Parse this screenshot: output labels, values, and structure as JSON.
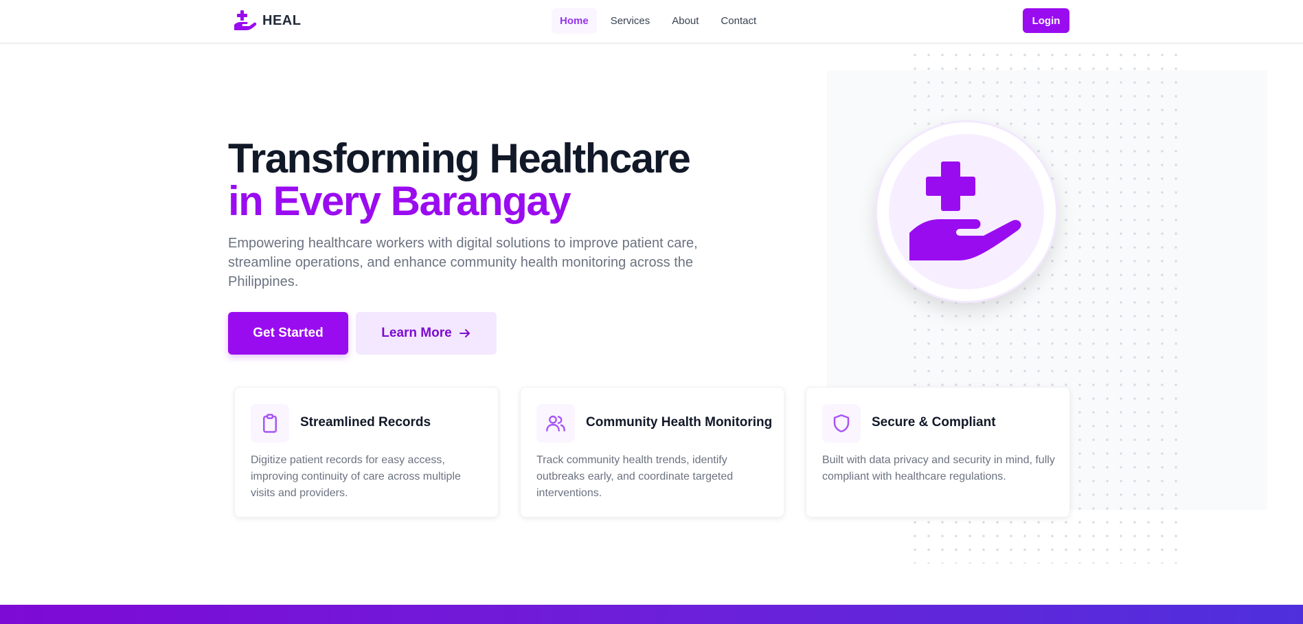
{
  "brand": {
    "name": "HEAL",
    "logo_icon": "hand-holding-medical-icon",
    "accent_color": "#9a0cf0"
  },
  "nav": {
    "items": [
      {
        "label": "Home",
        "active": true
      },
      {
        "label": "Services",
        "active": false
      },
      {
        "label": "About",
        "active": false
      },
      {
        "label": "Contact",
        "active": false
      }
    ],
    "login_label": "Login"
  },
  "hero": {
    "title_line1": "Transforming Healthcare",
    "title_line2": "in Every Barangay",
    "subtitle": "Empowering healthcare workers with digital solutions to improve patient care, streamline operations, and enhance community health monitoring across the Philippines.",
    "primary_cta": "Get Started",
    "secondary_cta": "Learn More",
    "secondary_cta_icon": "arrow-right-icon",
    "illustration_icon": "hand-holding-medical-icon"
  },
  "features": [
    {
      "icon": "clipboard-icon",
      "title": "Streamlined Records",
      "text": "Digitize patient records for easy access, improving continuity of care across multiple visits and providers."
    },
    {
      "icon": "users-icon",
      "title": "Community Health Monitoring",
      "text": "Track community health trends, identify outbreaks early, and coordinate targeted interventions."
    },
    {
      "icon": "shield-icon",
      "title": "Secure & Compliant",
      "text": "Built with data privacy and security in mind, fully compliant with healthcare regulations."
    }
  ]
}
